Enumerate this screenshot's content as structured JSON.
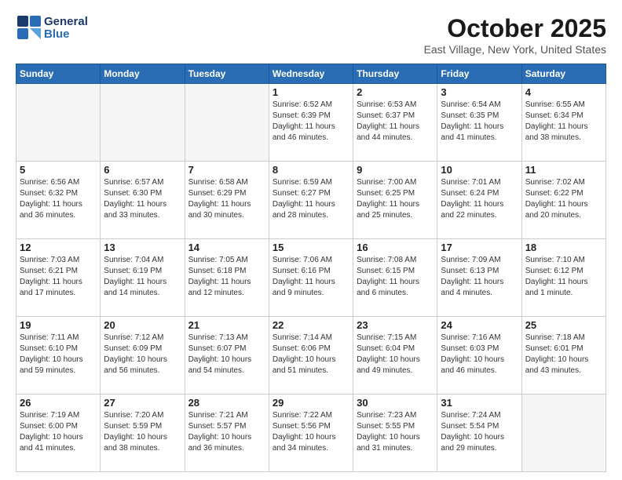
{
  "header": {
    "logo_line1": "General",
    "logo_line2": "Blue",
    "month": "October 2025",
    "location": "East Village, New York, United States"
  },
  "days_of_week": [
    "Sunday",
    "Monday",
    "Tuesday",
    "Wednesday",
    "Thursday",
    "Friday",
    "Saturday"
  ],
  "weeks": [
    [
      {
        "day": "",
        "text": ""
      },
      {
        "day": "",
        "text": ""
      },
      {
        "day": "",
        "text": ""
      },
      {
        "day": "1",
        "text": "Sunrise: 6:52 AM\nSunset: 6:39 PM\nDaylight: 11 hours\nand 46 minutes."
      },
      {
        "day": "2",
        "text": "Sunrise: 6:53 AM\nSunset: 6:37 PM\nDaylight: 11 hours\nand 44 minutes."
      },
      {
        "day": "3",
        "text": "Sunrise: 6:54 AM\nSunset: 6:35 PM\nDaylight: 11 hours\nand 41 minutes."
      },
      {
        "day": "4",
        "text": "Sunrise: 6:55 AM\nSunset: 6:34 PM\nDaylight: 11 hours\nand 38 minutes."
      }
    ],
    [
      {
        "day": "5",
        "text": "Sunrise: 6:56 AM\nSunset: 6:32 PM\nDaylight: 11 hours\nand 36 minutes."
      },
      {
        "day": "6",
        "text": "Sunrise: 6:57 AM\nSunset: 6:30 PM\nDaylight: 11 hours\nand 33 minutes."
      },
      {
        "day": "7",
        "text": "Sunrise: 6:58 AM\nSunset: 6:29 PM\nDaylight: 11 hours\nand 30 minutes."
      },
      {
        "day": "8",
        "text": "Sunrise: 6:59 AM\nSunset: 6:27 PM\nDaylight: 11 hours\nand 28 minutes."
      },
      {
        "day": "9",
        "text": "Sunrise: 7:00 AM\nSunset: 6:25 PM\nDaylight: 11 hours\nand 25 minutes."
      },
      {
        "day": "10",
        "text": "Sunrise: 7:01 AM\nSunset: 6:24 PM\nDaylight: 11 hours\nand 22 minutes."
      },
      {
        "day": "11",
        "text": "Sunrise: 7:02 AM\nSunset: 6:22 PM\nDaylight: 11 hours\nand 20 minutes."
      }
    ],
    [
      {
        "day": "12",
        "text": "Sunrise: 7:03 AM\nSunset: 6:21 PM\nDaylight: 11 hours\nand 17 minutes."
      },
      {
        "day": "13",
        "text": "Sunrise: 7:04 AM\nSunset: 6:19 PM\nDaylight: 11 hours\nand 14 minutes."
      },
      {
        "day": "14",
        "text": "Sunrise: 7:05 AM\nSunset: 6:18 PM\nDaylight: 11 hours\nand 12 minutes."
      },
      {
        "day": "15",
        "text": "Sunrise: 7:06 AM\nSunset: 6:16 PM\nDaylight: 11 hours\nand 9 minutes."
      },
      {
        "day": "16",
        "text": "Sunrise: 7:08 AM\nSunset: 6:15 PM\nDaylight: 11 hours\nand 6 minutes."
      },
      {
        "day": "17",
        "text": "Sunrise: 7:09 AM\nSunset: 6:13 PM\nDaylight: 11 hours\nand 4 minutes."
      },
      {
        "day": "18",
        "text": "Sunrise: 7:10 AM\nSunset: 6:12 PM\nDaylight: 11 hours\nand 1 minute."
      }
    ],
    [
      {
        "day": "19",
        "text": "Sunrise: 7:11 AM\nSunset: 6:10 PM\nDaylight: 10 hours\nand 59 minutes."
      },
      {
        "day": "20",
        "text": "Sunrise: 7:12 AM\nSunset: 6:09 PM\nDaylight: 10 hours\nand 56 minutes."
      },
      {
        "day": "21",
        "text": "Sunrise: 7:13 AM\nSunset: 6:07 PM\nDaylight: 10 hours\nand 54 minutes."
      },
      {
        "day": "22",
        "text": "Sunrise: 7:14 AM\nSunset: 6:06 PM\nDaylight: 10 hours\nand 51 minutes."
      },
      {
        "day": "23",
        "text": "Sunrise: 7:15 AM\nSunset: 6:04 PM\nDaylight: 10 hours\nand 49 minutes."
      },
      {
        "day": "24",
        "text": "Sunrise: 7:16 AM\nSunset: 6:03 PM\nDaylight: 10 hours\nand 46 minutes."
      },
      {
        "day": "25",
        "text": "Sunrise: 7:18 AM\nSunset: 6:01 PM\nDaylight: 10 hours\nand 43 minutes."
      }
    ],
    [
      {
        "day": "26",
        "text": "Sunrise: 7:19 AM\nSunset: 6:00 PM\nDaylight: 10 hours\nand 41 minutes."
      },
      {
        "day": "27",
        "text": "Sunrise: 7:20 AM\nSunset: 5:59 PM\nDaylight: 10 hours\nand 38 minutes."
      },
      {
        "day": "28",
        "text": "Sunrise: 7:21 AM\nSunset: 5:57 PM\nDaylight: 10 hours\nand 36 minutes."
      },
      {
        "day": "29",
        "text": "Sunrise: 7:22 AM\nSunset: 5:56 PM\nDaylight: 10 hours\nand 34 minutes."
      },
      {
        "day": "30",
        "text": "Sunrise: 7:23 AM\nSunset: 5:55 PM\nDaylight: 10 hours\nand 31 minutes."
      },
      {
        "day": "31",
        "text": "Sunrise: 7:24 AM\nSunset: 5:54 PM\nDaylight: 10 hours\nand 29 minutes."
      },
      {
        "day": "",
        "text": ""
      }
    ]
  ]
}
